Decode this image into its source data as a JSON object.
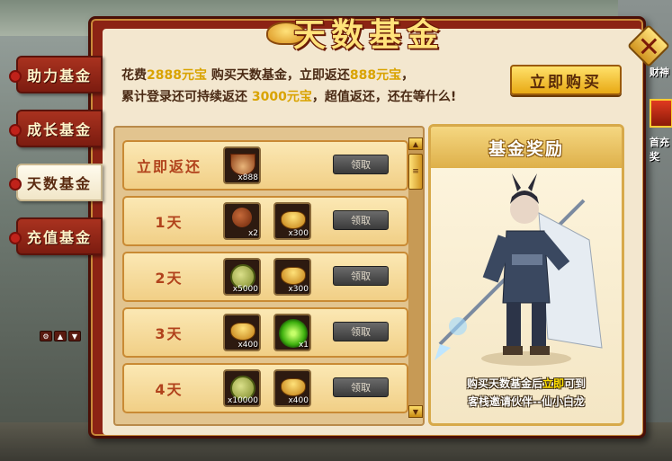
{
  "title": "天数基金",
  "intro": {
    "line1_pre": "花费",
    "line1_cost": "2888元宝",
    "line1_mid": " 购买天数基金，立即返还",
    "line1_return": "888元宝",
    "line1_end": "，",
    "line2_pre": "累计登录还可持续返还 ",
    "line2_total": "3000元宝",
    "line2_end": "，超值返还，还在等什么!"
  },
  "buy_button": "立即购买",
  "side_tabs": [
    "助力基金",
    "成长基金",
    "天数基金",
    "充值基金"
  ],
  "active_tab": 2,
  "claim_label": "领取",
  "rows": [
    {
      "label": "立即返还",
      "items": [
        {
          "icon": "ingot-bowl-icon",
          "count": "x888"
        }
      ]
    },
    {
      "label": "1天",
      "items": [
        {
          "icon": "meat-dish-icon",
          "count": "x2"
        },
        {
          "icon": "gold-ingot-icon",
          "count": "x300"
        }
      ]
    },
    {
      "label": "2天",
      "items": [
        {
          "icon": "copper-coin-icon",
          "count": "x5000"
        },
        {
          "icon": "gold-ingot-icon",
          "count": "x300"
        }
      ]
    },
    {
      "label": "3天",
      "items": [
        {
          "icon": "gold-ingot-icon",
          "count": "x400"
        },
        {
          "icon": "green-orb-icon",
          "count": "x1"
        }
      ]
    },
    {
      "label": "4天",
      "items": [
        {
          "icon": "copper-coin-icon",
          "count": "x10000"
        },
        {
          "icon": "gold-ingot-icon",
          "count": "x400"
        }
      ]
    }
  ],
  "reward": {
    "title": "基金奖励",
    "desc_pre": "购买天数基金后",
    "desc_hl": "立即",
    "desc_post": "可到",
    "desc_line2": "客栈邀请伙伴--仙小白龙"
  },
  "right_labels": [
    "财神",
    "首充奖"
  ],
  "colors": {
    "frame": "#8c2314",
    "highlight": "#d9a300",
    "tab_active": "#f1e6c8"
  }
}
